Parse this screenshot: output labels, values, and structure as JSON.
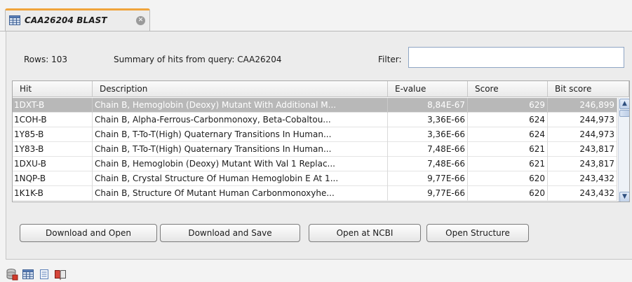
{
  "tab": {
    "title": "CAA26204 BLAST",
    "icon": "table-icon",
    "close_icon": "close-circle-icon",
    "accent_color": "#f0a43c"
  },
  "info": {
    "rows_label": "Rows: 103",
    "summary_label": "Summary of hits from query: CAA26204",
    "filter_label": "Filter:",
    "filter_value": ""
  },
  "table": {
    "columns": [
      "Hit",
      "Description",
      "E-value",
      "Score",
      "Bit score"
    ],
    "rows": [
      {
        "hit": "1DXT-B",
        "description": "Chain B, Hemoglobin (Deoxy) Mutant With Additional M...",
        "evalue": "8,84E-67",
        "score": "629",
        "bit": "246,899",
        "selected": true
      },
      {
        "hit": "1COH-B",
        "description": "Chain B, Alpha-Ferrous-Carbonmonoxy, Beta-Cobaltou...",
        "evalue": "3,36E-66",
        "score": "624",
        "bit": "244,973"
      },
      {
        "hit": "1Y85-B",
        "description": "Chain B, T-To-T(High) Quaternary Transitions In Human...",
        "evalue": "3,36E-66",
        "score": "624",
        "bit": "244,973"
      },
      {
        "hit": "1Y83-B",
        "description": "Chain B, T-To-T(High) Quaternary Transitions In Human...",
        "evalue": "7,48E-66",
        "score": "621",
        "bit": "243,817"
      },
      {
        "hit": "1DXU-B",
        "description": "Chain B, Hemoglobin (Deoxy) Mutant With Val 1 Replac...",
        "evalue": "7,48E-66",
        "score": "621",
        "bit": "243,817"
      },
      {
        "hit": "1NQP-B",
        "description": "Chain B, Crystal Structure Of Human Hemoglobin E At 1...",
        "evalue": "9,77E-66",
        "score": "620",
        "bit": "243,432"
      },
      {
        "hit": "1K1K-B",
        "description": "Chain B, Structure Of Mutant Human Carbonmonoxyhe...",
        "evalue": "9,77E-66",
        "score": "620",
        "bit": "243,432"
      }
    ],
    "selected_row_color": "#b8b8b8"
  },
  "buttons": {
    "download_open": "Download and Open",
    "download_save": "Download and Save",
    "open_ncbi": "Open at NCBI",
    "open_structure": "Open Structure"
  },
  "bottom_toolbar": {
    "icons": [
      "database-icon",
      "table-icon",
      "text-document-icon",
      "book-icon"
    ]
  }
}
